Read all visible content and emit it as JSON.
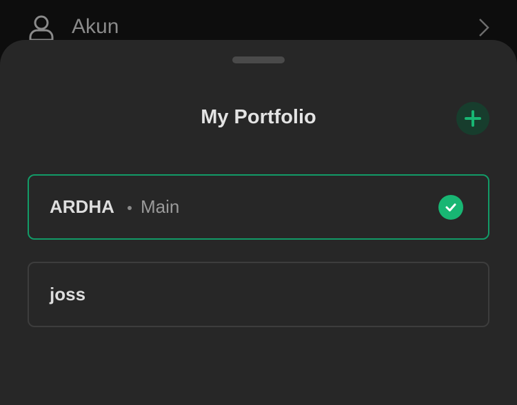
{
  "background": {
    "menu_item_label": "Akun",
    "icon": "user-icon",
    "chevron": "chevron-right-icon"
  },
  "sheet": {
    "title": "My Portfolio",
    "add_icon": "plus-icon"
  },
  "portfolios": [
    {
      "name": "ARDHA",
      "subtitle": "Main",
      "selected": true
    },
    {
      "name": "joss",
      "subtitle": "",
      "selected": false
    }
  ],
  "colors": {
    "accent": "#18b673",
    "selected_border": "#129c68",
    "add_button_bg": "#173d2d"
  }
}
